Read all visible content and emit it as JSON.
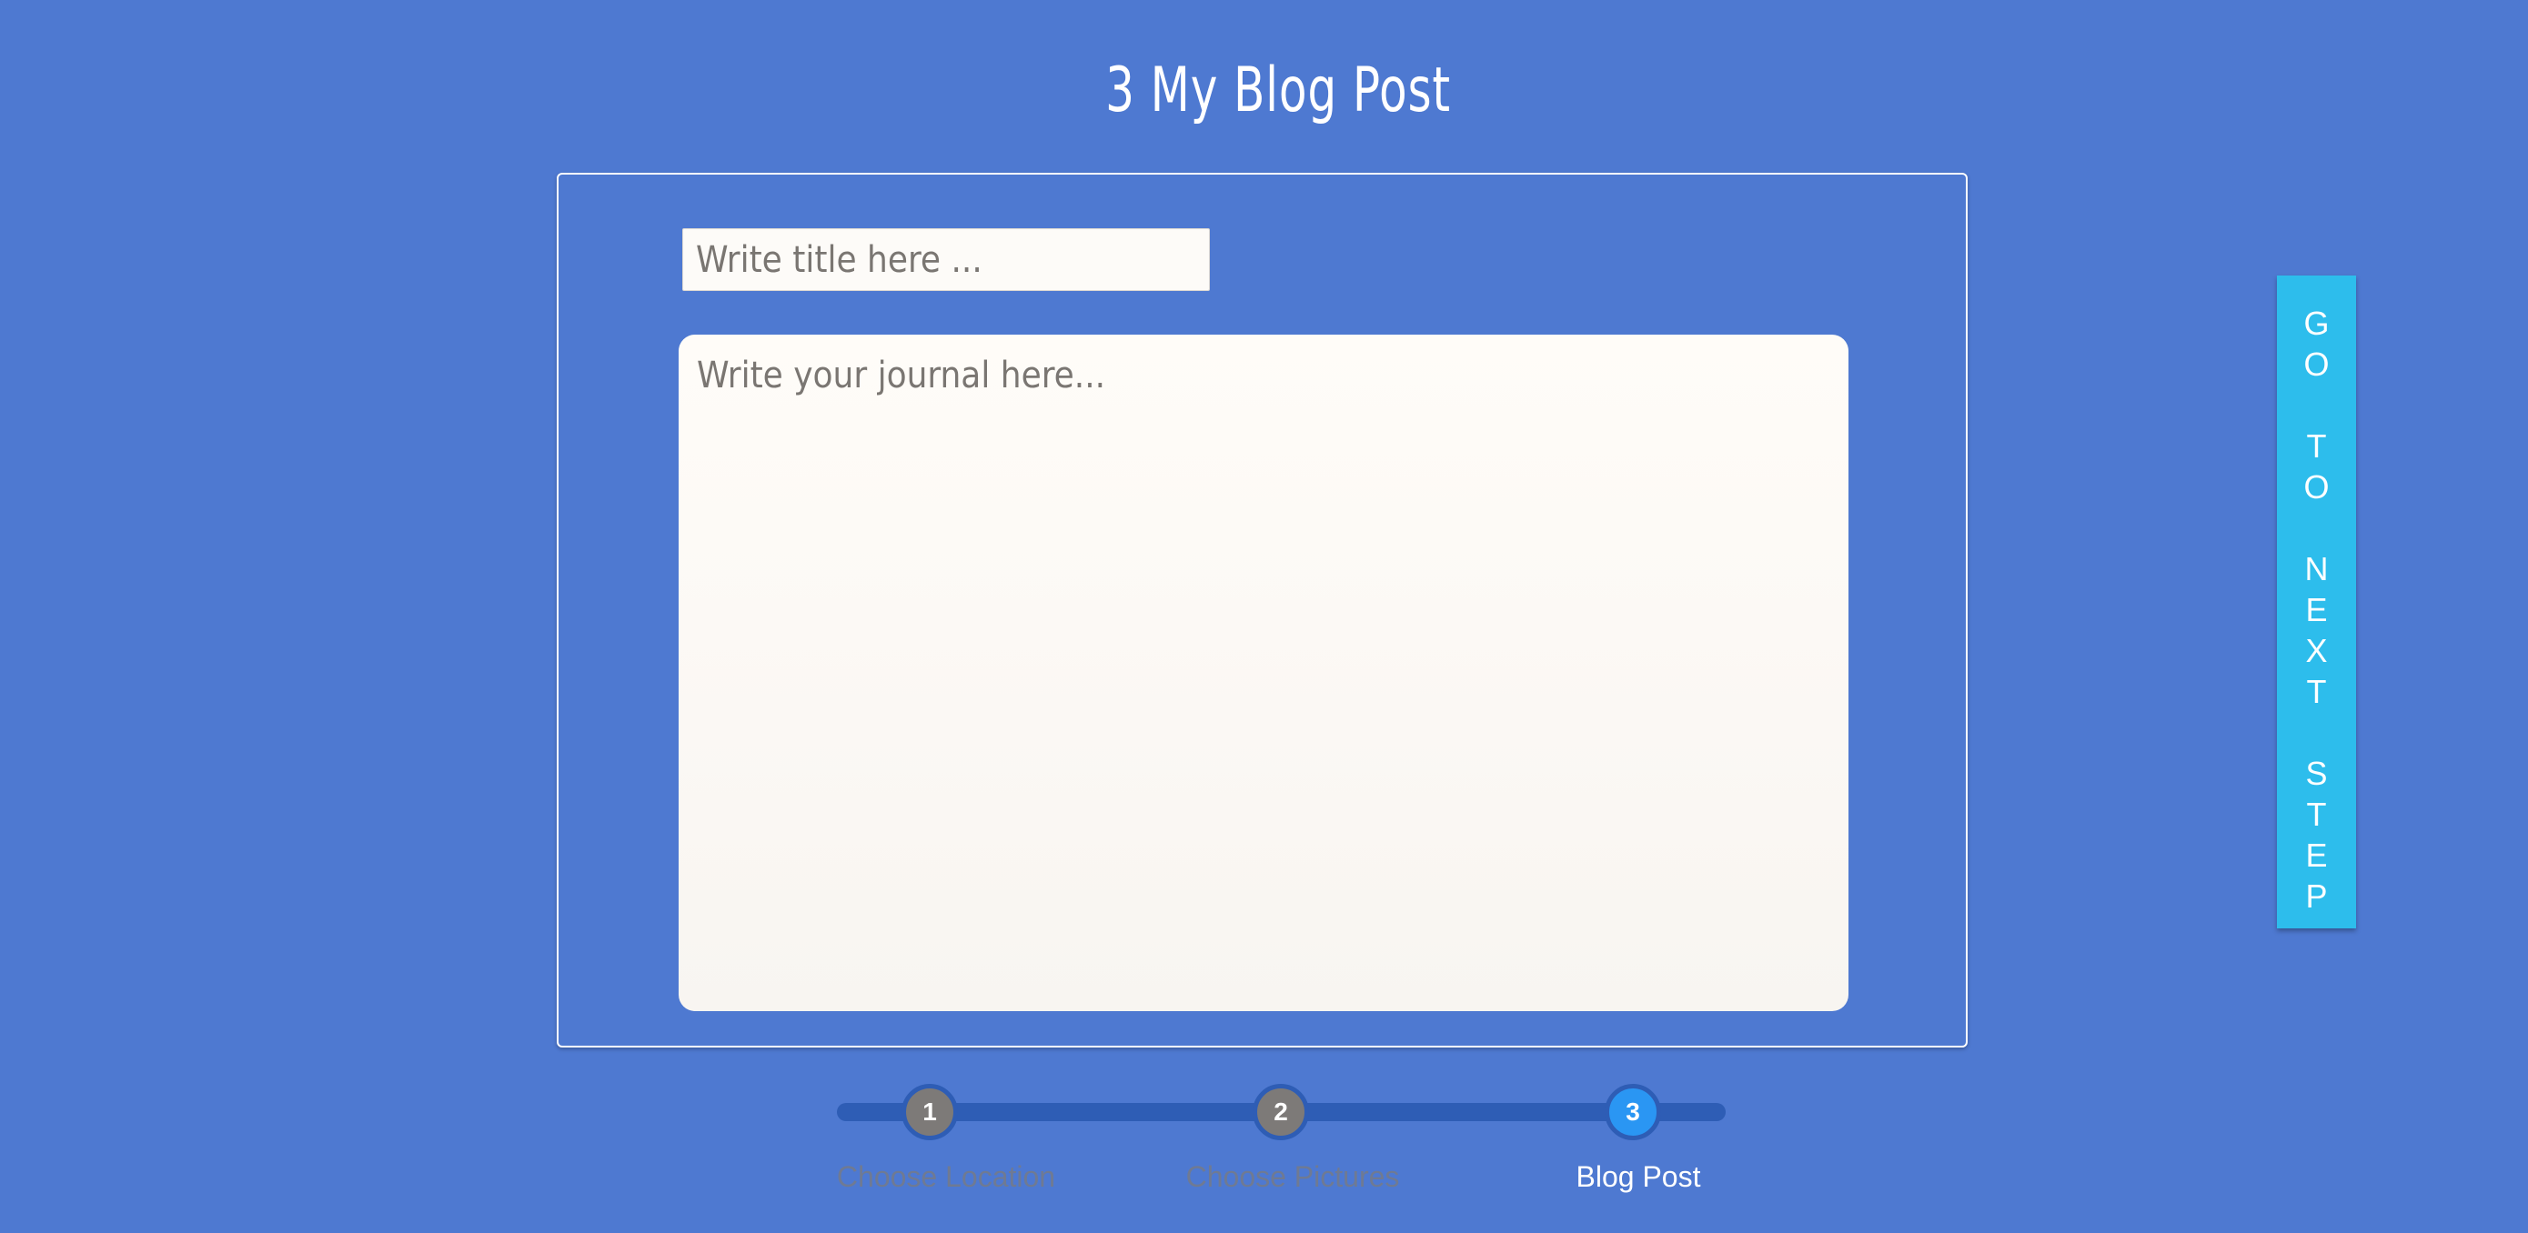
{
  "page": {
    "title": "3 My Blog Post"
  },
  "editor": {
    "title_placeholder": "Write title here ...",
    "title_value": "",
    "journal_placeholder": "Write your journal here...",
    "journal_value": ""
  },
  "next_button": {
    "label": "GO TO NEXT STEP",
    "letters": [
      "G",
      "O",
      "",
      "T",
      "O",
      "",
      "N",
      "E",
      "X",
      "T",
      "",
      "S",
      "T",
      "E",
      "P"
    ]
  },
  "progress": {
    "steps": [
      {
        "number": "1",
        "label": "Choose Location",
        "state": "inactive"
      },
      {
        "number": "2",
        "label": "Choose Pictures",
        "state": "inactive"
      },
      {
        "number": "3",
        "label": "Blog Post",
        "state": "active"
      }
    ],
    "colors": {
      "inactive_node": "#7d7a78",
      "active_node": "#2a96f3",
      "track": "#2e5db5",
      "inactive_label": "#6f7a93",
      "active_label": "#ffffff"
    }
  },
  "colors": {
    "background": "#4e79d1",
    "next_button": "#2dbdec",
    "panel_border": "#ffffff"
  }
}
